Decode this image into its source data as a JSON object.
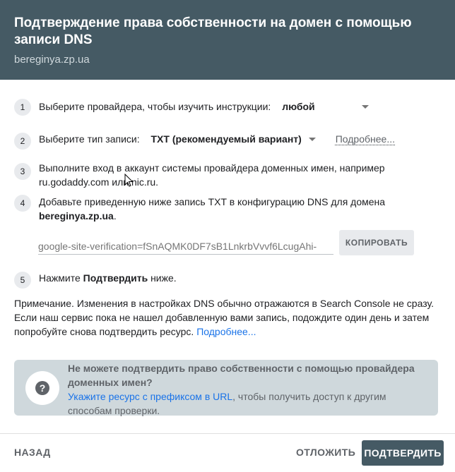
{
  "header": {
    "title": "Подтверждение права собственности на домен с помощью записи DNS",
    "domain": "bereginya.zp.ua"
  },
  "steps": [
    {
      "num": "1",
      "text": "Выберите провайдера, чтобы изучить инструкции:",
      "select_value": "любой"
    },
    {
      "num": "2",
      "text": "Выберите тип записи:",
      "select_value": "TXT (рекомендуемый вариант)",
      "link": "Подробнее..."
    },
    {
      "num": "3",
      "text": "Выполните вход в аккаунт системы провайдера доменных имен, например ru.godaddy.com или nic.ru."
    },
    {
      "num": "4",
      "text_before": "Добавьте приведенную ниже запись TXT в конфигурацию DNS для домена ",
      "domain": "bereginya.zp.ua",
      "text_after": "."
    },
    {
      "num": "5",
      "text_before": "Нажмите ",
      "bold": "Подтвердить",
      "text_after": " ниже."
    }
  ],
  "record": {
    "value": "google-site-verification=fSnAQMK0DF7sB1LnkrbVvvf6LcugAhi-",
    "copy_label": "КОПИРОВАТЬ"
  },
  "note": {
    "text": "Примечание. Изменения в настройках DNS обычно отражаются в Search Console не сразу. Если наш сервис пока не нашел добавленную вами запись, подождите один день и затем попробуйте снова подтвердить ресурс. ",
    "link": "Подробнее..."
  },
  "info": {
    "icon": "help-icon",
    "title": "Не можете подтвердить право собственности с помощью провайдера доменных имен?",
    "link": "Укажите ресурс с префиксом в URL",
    "text": ", чтобы получить доступ к другим способам проверки."
  },
  "footer": {
    "back_label": "НАЗАД",
    "later_label": "ОТЛОЖИТЬ",
    "verify_label": "ПОДТВЕРДИТЬ"
  },
  "colors": {
    "header_bg": "#455a64",
    "info_bg": "#cfd8dc",
    "link": "#1a73e8",
    "primary_button": "#455a64"
  }
}
